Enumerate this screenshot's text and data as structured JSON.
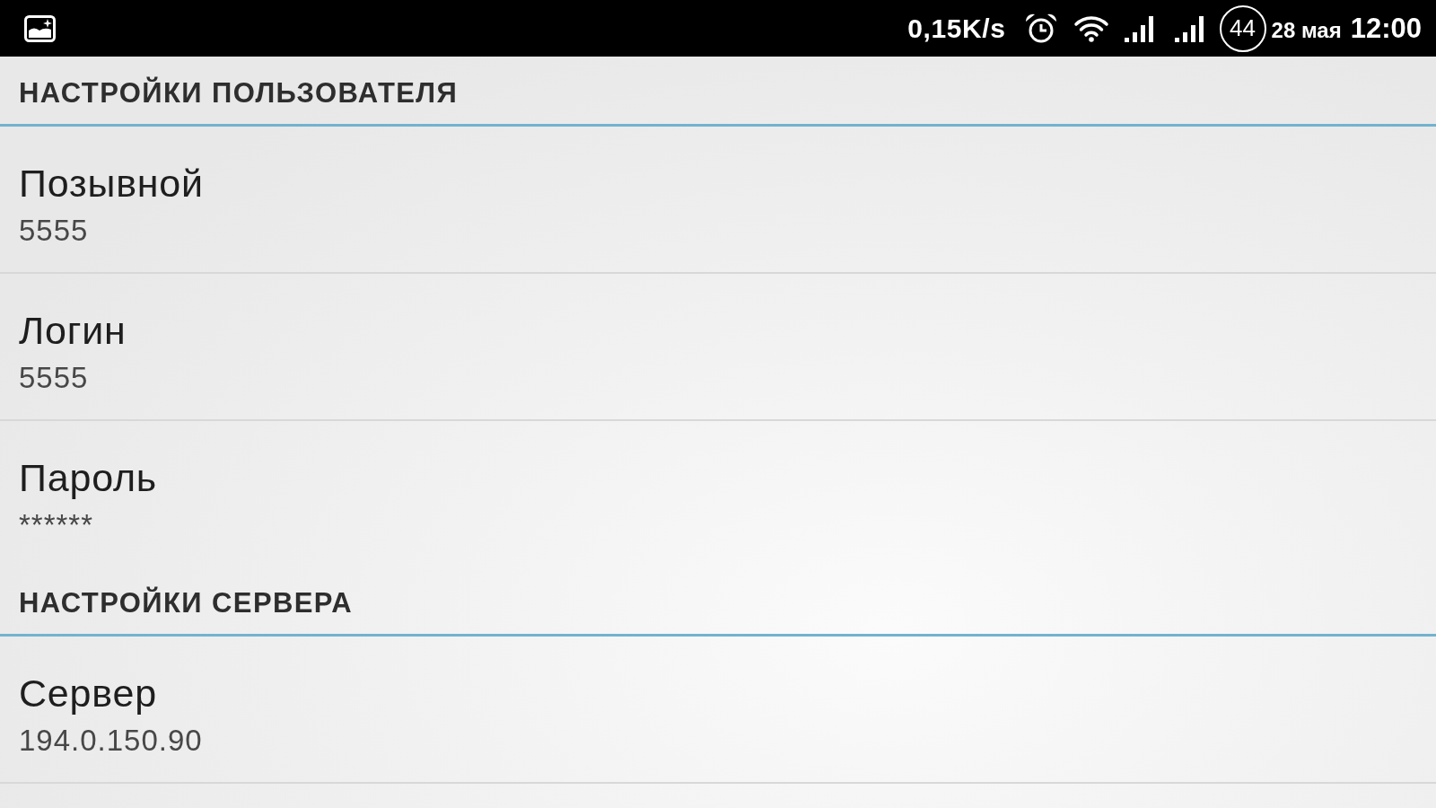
{
  "status_bar": {
    "network_speed": "0,15K/s",
    "battery": "44",
    "date": "28 мая",
    "time": "12:00"
  },
  "sections": [
    {
      "title": "НАСТРОЙКИ ПОЛЬЗОВАТЕЛЯ",
      "items": [
        {
          "title": "Позывной",
          "summary": "5555"
        },
        {
          "title": "Логин",
          "summary": "5555"
        },
        {
          "title": "Пароль",
          "summary": "******"
        }
      ]
    },
    {
      "title": "НАСТРОЙКИ СЕРВЕРА",
      "items": [
        {
          "title": "Сервер",
          "summary": "194.0.150.90"
        }
      ]
    }
  ]
}
